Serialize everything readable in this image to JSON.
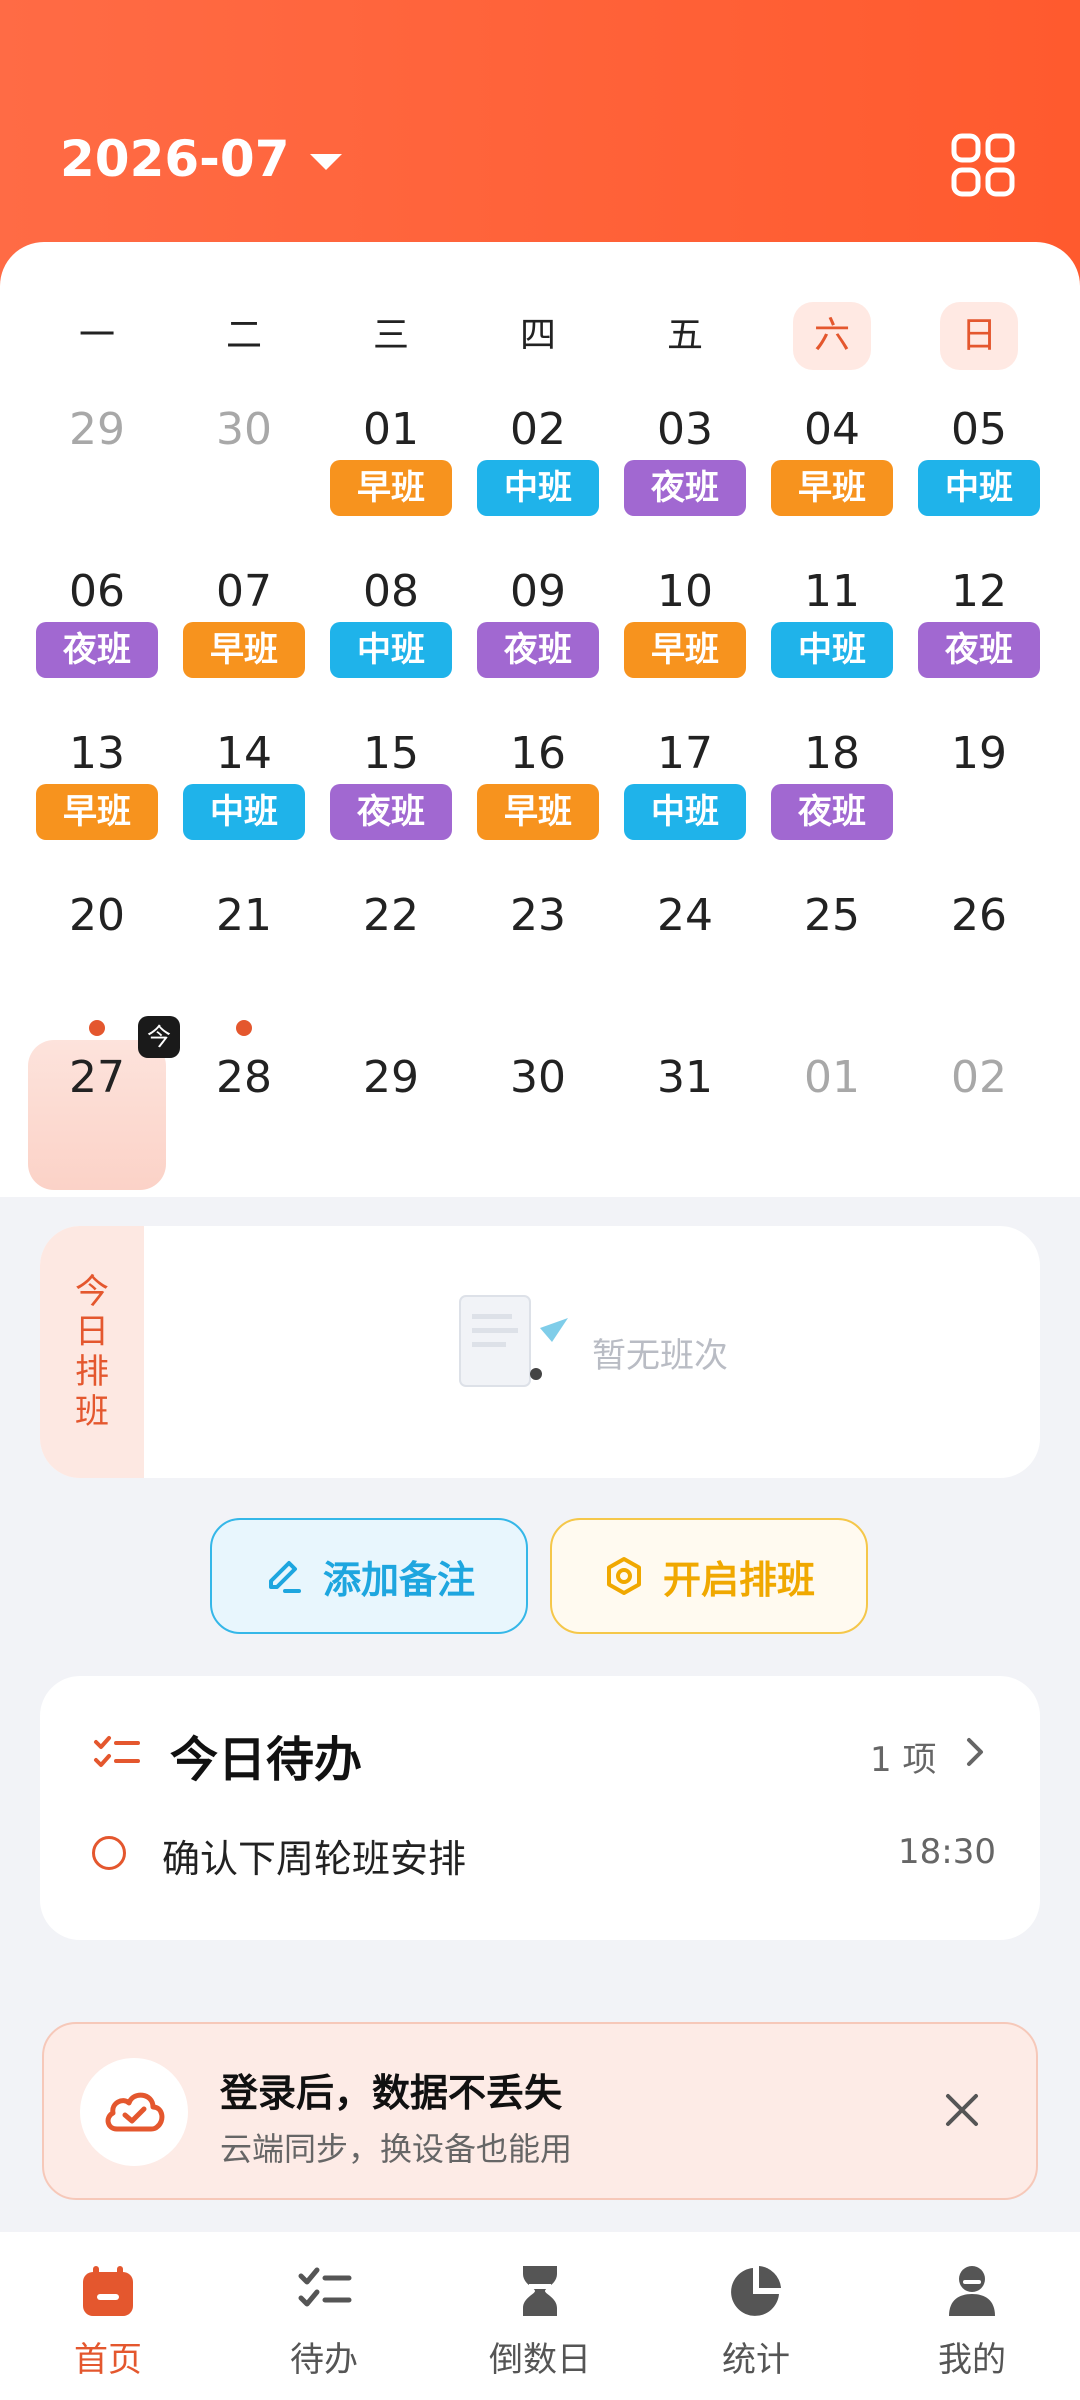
{
  "header": {
    "month": "2026-07"
  },
  "weekdays": [
    "一",
    "二",
    "三",
    "四",
    "五",
    "六",
    "日"
  ],
  "calendar": {
    "weeks": [
      [
        {
          "day": "29",
          "muted": true
        },
        {
          "day": "30",
          "muted": true
        },
        {
          "day": "01",
          "shift": "早班"
        },
        {
          "day": "02",
          "shift": "中班"
        },
        {
          "day": "03",
          "shift": "夜班"
        },
        {
          "day": "04",
          "shift": "早班"
        },
        {
          "day": "05",
          "shift": "中班"
        }
      ],
      [
        {
          "day": "06",
          "shift": "夜班"
        },
        {
          "day": "07",
          "shift": "早班"
        },
        {
          "day": "08",
          "shift": "中班"
        },
        {
          "day": "09",
          "shift": "夜班"
        },
        {
          "day": "10",
          "shift": "早班"
        },
        {
          "day": "11",
          "shift": "中班"
        },
        {
          "day": "12",
          "shift": "夜班"
        }
      ],
      [
        {
          "day": "13",
          "shift": "早班"
        },
        {
          "day": "14",
          "shift": "中班"
        },
        {
          "day": "15",
          "shift": "夜班"
        },
        {
          "day": "16",
          "shift": "早班"
        },
        {
          "day": "17",
          "shift": "中班"
        },
        {
          "day": "18",
          "shift": "夜班"
        },
        {
          "day": "19"
        }
      ],
      [
        {
          "day": "20"
        },
        {
          "day": "21"
        },
        {
          "day": "22"
        },
        {
          "day": "23"
        },
        {
          "day": "24"
        },
        {
          "day": "25"
        },
        {
          "day": "26"
        }
      ],
      [
        {
          "day": "27",
          "today": true,
          "dot": true
        },
        {
          "day": "28",
          "dot": true
        },
        {
          "day": "29"
        },
        {
          "day": "30"
        },
        {
          "day": "31"
        },
        {
          "day": "01",
          "muted": true
        },
        {
          "day": "02",
          "muted": true
        }
      ]
    ],
    "today_badge": "今",
    "shift_colors": {
      "早班": "#f7931e",
      "中班": "#1fb3ea",
      "夜班": "#a168d1"
    }
  },
  "schedule": {
    "side_label": [
      "今",
      "日",
      "排",
      "班"
    ],
    "empty_text": "暂无班次"
  },
  "actions": {
    "add_note": "添加备注",
    "start_shift": "开启排班"
  },
  "todo": {
    "title": "今日待办",
    "count": "1 项",
    "items": [
      {
        "text": "确认下周轮班安排",
        "time": "18:30"
      }
    ]
  },
  "login_banner": {
    "title": "登录后，数据不丢失",
    "subtitle": "云端同步，换设备也能用"
  },
  "tabs": [
    {
      "label": "首页",
      "icon": "calendar-icon",
      "active": true
    },
    {
      "label": "待办",
      "icon": "checklist-icon"
    },
    {
      "label": "倒数日",
      "icon": "hourglass-icon"
    },
    {
      "label": "统计",
      "icon": "pie-chart-icon"
    },
    {
      "label": "我的",
      "icon": "user-icon"
    }
  ],
  "accent": "#e4572e"
}
